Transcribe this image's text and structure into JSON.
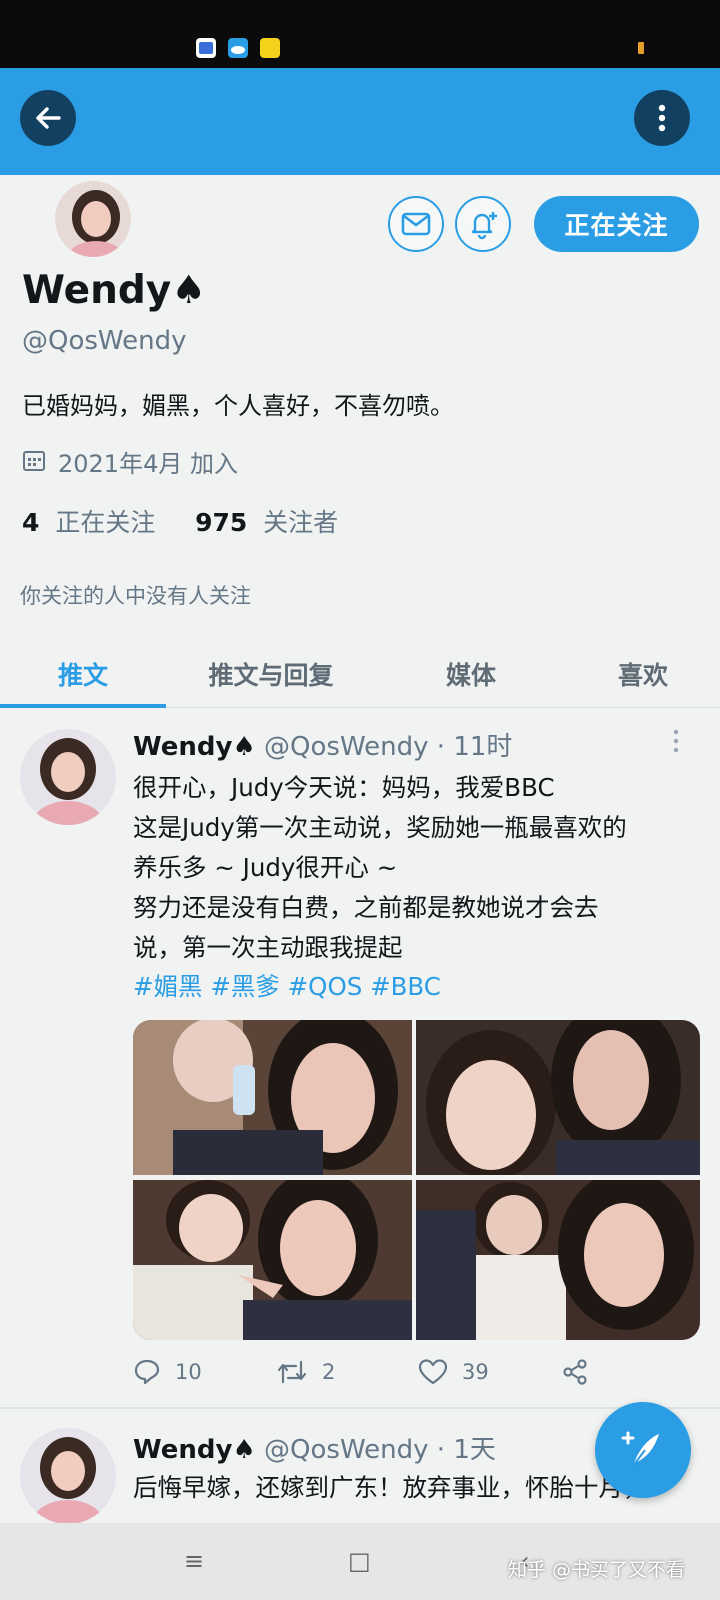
{
  "app_bar": {
    "back_icon": "arrow-left-icon",
    "more_icon": "more-vertical-icon",
    "color": "#2b9de4"
  },
  "profile": {
    "name": "Wendy",
    "name_emoji": "♠",
    "handle": "@QosWendy",
    "bio": "已婚妈妈，媚黑，个人喜好，不喜勿喷。",
    "joined": "2021年4月 加入",
    "following_count": "4",
    "following_label": "正在关注",
    "followers_count": "975",
    "followers_label": "关注者",
    "followed_by_note": "你关注的人中没有人关注",
    "follow_button_label": "正在关注"
  },
  "tabs": [
    {
      "label": "推文",
      "active": true
    },
    {
      "label": "推文与回复",
      "active": false
    },
    {
      "label": "媒体",
      "active": false
    },
    {
      "label": "喜欢",
      "active": false
    }
  ],
  "tweets": [
    {
      "name": "Wendy",
      "emoji": "♠",
      "handle": "@QosWendy",
      "separator": "·",
      "time": "11时",
      "lines": [
        "很开心，Judy今天说：妈妈，我爱BBC",
        "这是Judy第一次主动说，奖励她一瓶最喜欢的",
        "养乐多 ~ Judy很开心 ~",
        "努力还是没有白费，之前都是教她说才会去",
        "说，第一次主动跟我提起"
      ],
      "hashtags": "#媚黑 #黑爹 #QOS #BBC",
      "reply_count": "10",
      "retweet_count": "2",
      "like_count": "39"
    },
    {
      "name": "Wendy",
      "emoji": "♠",
      "handle": "@QosWendy",
      "separator": "·",
      "time": "1天",
      "lines": [
        "后悔早嫁，还嫁到广东！放弃事业，怀胎十月，"
      ]
    }
  ],
  "system_nav": {
    "menu_icon": "≡",
    "home_icon": "□",
    "back_icon": "‹"
  },
  "watermark": "知乎 @书买了又不看"
}
